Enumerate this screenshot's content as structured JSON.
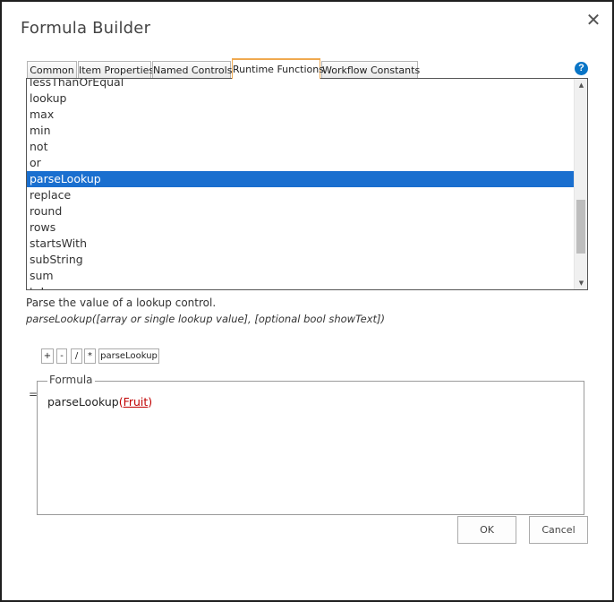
{
  "dialog": {
    "title": "Formula Builder",
    "close_symbol": "✕",
    "help_symbol": "?"
  },
  "tabs": [
    {
      "label": "Common",
      "active": false
    },
    {
      "label": "Item Properties",
      "active": false
    },
    {
      "label": "Named Controls",
      "active": false
    },
    {
      "label": "Runtime Functions",
      "active": true
    },
    {
      "label": "Workflow Constants",
      "active": false
    }
  ],
  "function_list": {
    "items": [
      "lessThanOrEqual",
      "lookup",
      "max",
      "min",
      "not",
      "or",
      "parseLookup",
      "replace",
      "round",
      "rows",
      "startsWith",
      "subString",
      "sum",
      "toLower"
    ],
    "selected": "parseLookup"
  },
  "function_info": {
    "description": "Parse the value of a lookup control.",
    "signature": "parseLookup([array or single lookup value], [optional bool showText])"
  },
  "operators": [
    "+",
    "-",
    "/",
    "*",
    "parseLookup"
  ],
  "formula": {
    "legend": "Formula",
    "equals": "=",
    "function_name": "parseLookup",
    "open_paren": "(",
    "argument": "Fruit",
    "close_paren": ")"
  },
  "buttons": {
    "ok": "OK",
    "cancel": "Cancel"
  },
  "colors": {
    "selection": "#1a6fcf",
    "active_tab_border": "#f0a950",
    "help_icon": "#0a75c6",
    "argument_text": "#c00000"
  }
}
